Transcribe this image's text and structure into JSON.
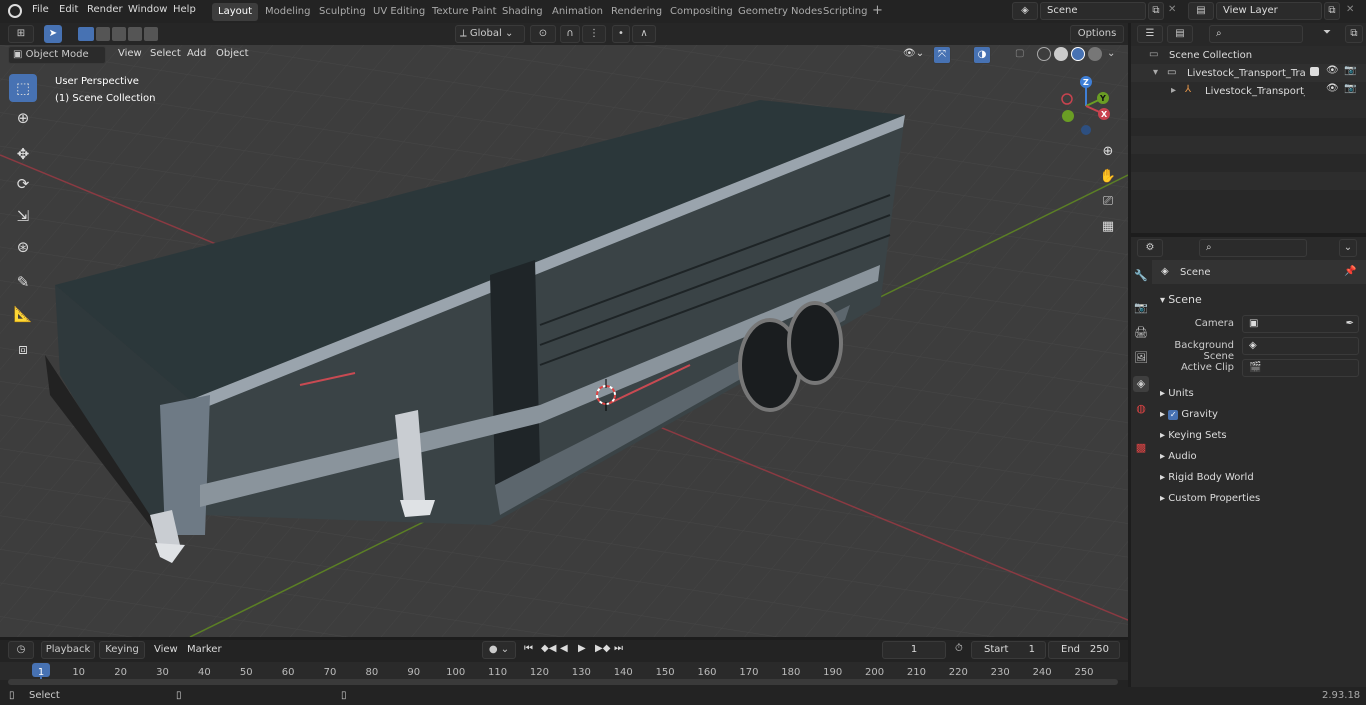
{
  "topbar": {
    "menus": [
      "File",
      "Edit",
      "Render",
      "Window",
      "Help"
    ],
    "workspaces": [
      "Layout",
      "Modeling",
      "Sculpting",
      "UV Editing",
      "Texture Paint",
      "Shading",
      "Animation",
      "Rendering",
      "Compositing",
      "Geometry Nodes",
      "Scripting"
    ],
    "active_workspace": "Layout",
    "add_tab": "+",
    "scene": "Scene",
    "view_layer": "View Layer"
  },
  "viewport_header": {
    "mode": "Object Mode",
    "menus": [
      "View",
      "Select",
      "Add",
      "Object"
    ],
    "orientation": "Global",
    "options": "Options"
  },
  "viewport": {
    "perspective": "User Perspective",
    "collection": "(1) Scene Collection",
    "gizmo": {
      "z": "Z",
      "y": "Y",
      "x": "X"
    }
  },
  "outliner": {
    "root": "Scene Collection",
    "items": [
      {
        "label": "Livestock_Transport_Trailer_N"
      },
      {
        "label": "Livestock_Transport_Trai"
      }
    ]
  },
  "properties": {
    "context": "Scene",
    "panel": "Scene",
    "fields": [
      {
        "label": "Camera"
      },
      {
        "label": "Background Scene"
      },
      {
        "label": "Active Clip"
      }
    ],
    "sections": [
      "Units",
      "Gravity",
      "Keying Sets",
      "Audio",
      "Rigid Body World",
      "Custom Properties"
    ]
  },
  "timeline": {
    "menus": [
      "Playback",
      "Keying",
      "View",
      "Marker"
    ],
    "current_frame": "1",
    "start_label": "Start",
    "start": "1",
    "end_label": "End",
    "end": "250",
    "ticks": [
      "1",
      "10",
      "20",
      "30",
      "40",
      "50",
      "60",
      "70",
      "80",
      "90",
      "100",
      "110",
      "120",
      "130",
      "140",
      "150",
      "160",
      "170",
      "180",
      "190",
      "200",
      "210",
      "220",
      "230",
      "240",
      "250"
    ]
  },
  "statusbar": {
    "select": "Select",
    "version": "2.93.18"
  },
  "colors": {
    "accent": "#4772b3",
    "x_axis": "#c8434f",
    "y_axis": "#6a9d24",
    "z_axis": "#3f7fd7"
  }
}
